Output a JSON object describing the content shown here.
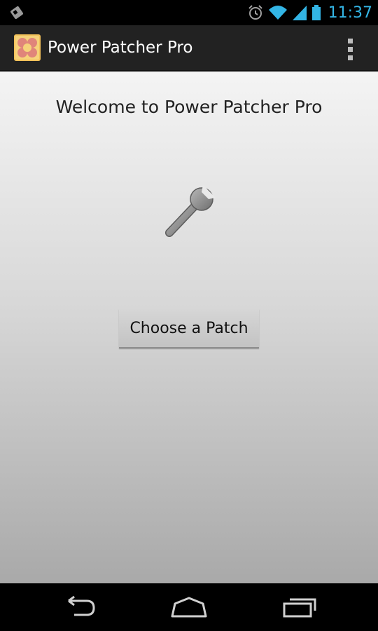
{
  "status_bar": {
    "time": "11:37",
    "icons": [
      "notification-icon",
      "alarm-icon",
      "wifi-icon",
      "signal-icon",
      "battery-icon"
    ],
    "time_color": "#33b5e5"
  },
  "action_bar": {
    "title": "Power Patcher Pro",
    "app_icon": "power-patcher-app-icon",
    "overflow_icon": "overflow-menu-icon"
  },
  "main": {
    "welcome_text": "Welcome to Power Patcher Pro",
    "center_icon": "wrench-icon",
    "choose_button_label": "Choose a Patch"
  },
  "nav_bar": {
    "icons": [
      "back-icon",
      "home-icon",
      "recent-apps-icon"
    ]
  }
}
